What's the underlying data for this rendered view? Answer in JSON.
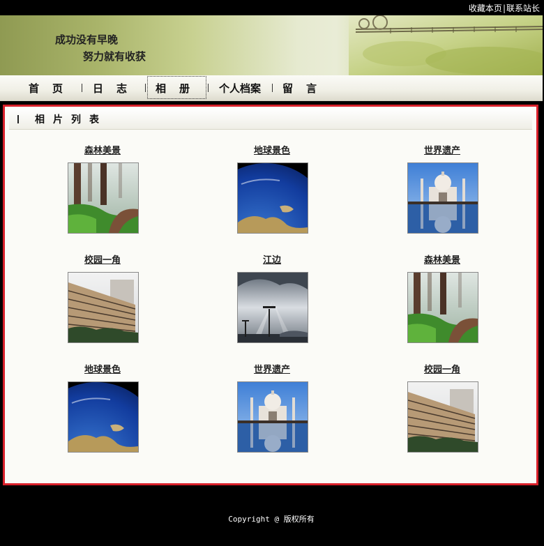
{
  "topbar": {
    "bookmark_label": "收藏本页",
    "separator": "|",
    "contact_label": "联系站长"
  },
  "banner": {
    "slogan_line1": "成功没有早晚",
    "slogan_line2": "努力就有收获"
  },
  "nav": {
    "items": [
      "首　页",
      "日　志",
      "相　册",
      "个人档案",
      "留　言"
    ],
    "active_index": 2
  },
  "panel": {
    "title": "相片列表"
  },
  "photos": [
    {
      "caption": "森林美景",
      "image": "forest"
    },
    {
      "caption": "地球景色",
      "image": "earth"
    },
    {
      "caption": "世界遗产",
      "image": "taj-mahal"
    },
    {
      "caption": "校园一角",
      "image": "campus"
    },
    {
      "caption": "江边",
      "image": "riverside"
    },
    {
      "caption": "森林美景",
      "image": "forest"
    },
    {
      "caption": "地球景色",
      "image": "earth"
    },
    {
      "caption": "世界遗产",
      "image": "taj-mahal"
    },
    {
      "caption": "校园一角",
      "image": "campus"
    }
  ],
  "footer": {
    "copyright": "Copyright @ 版权所有"
  },
  "colors": {
    "panel_border": "#d9202a",
    "background": "#000000",
    "panel_bg": "#fbfbf7"
  }
}
